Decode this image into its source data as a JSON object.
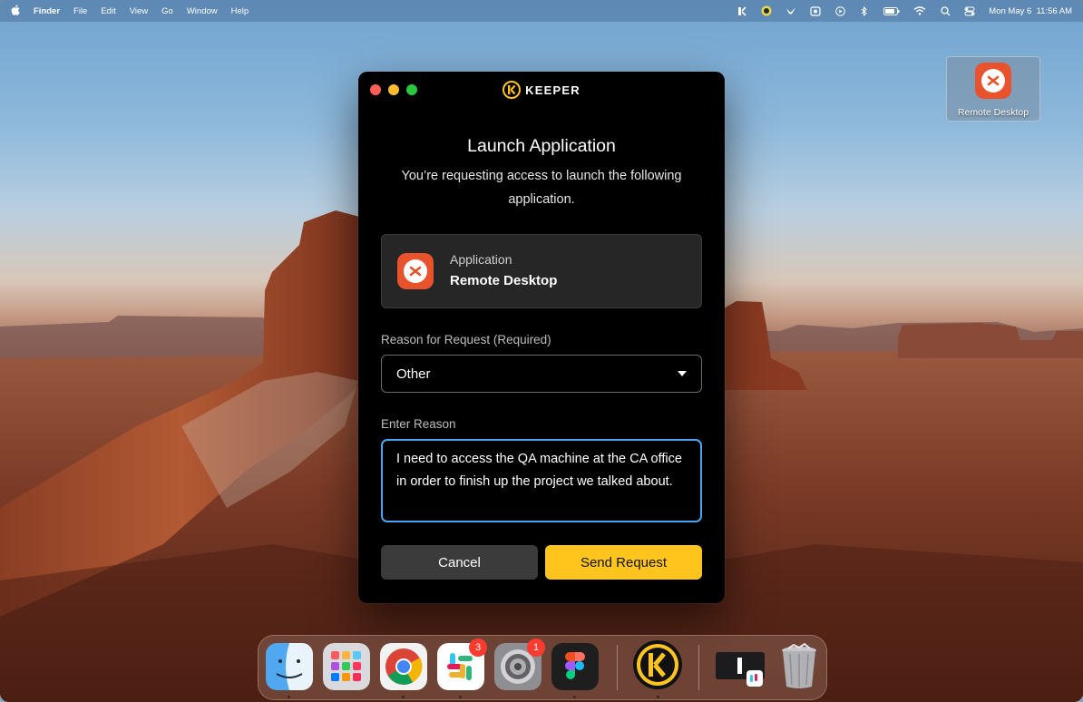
{
  "menubar": {
    "apple": "",
    "app_name": "Finder",
    "menus": [
      "File",
      "Edit",
      "View",
      "Go",
      "Window",
      "Help"
    ],
    "datetime": "Mon May 6  11:56 AM",
    "status_icons": [
      "keeper-icon",
      "sparrow-icon",
      "bird-icon",
      "screen-capture-icon",
      "play-icon",
      "bluetooth-icon",
      "battery-icon",
      "wifi-icon",
      "search-icon",
      "control-center-icon"
    ]
  },
  "desktop": {
    "icon_label": "Remote Desktop"
  },
  "dialog": {
    "brand": "KEEPER",
    "title": "Launch Application",
    "subtitle": "You’re requesting access to launch the following application.",
    "app_caption": "Application",
    "app_name": "Remote Desktop",
    "reason_label": "Reason for Request (Required)",
    "reason_value": "Other",
    "enter_label": "Enter Reason",
    "enter_value": "I need to access the QA machine at the CA office in order to finish up the project we talked about.",
    "cancel_label": "Cancel",
    "send_label": "Send Request"
  },
  "dock": {
    "apps": [
      "finder",
      "launchpad",
      "chrome",
      "slack",
      "system-settings",
      "figma",
      "keeper",
      "minimized-window",
      "trash"
    ],
    "badges": {
      "slack": "3",
      "system_settings": "1"
    }
  },
  "colors": {
    "accent": "#ffc51c",
    "focus": "#4ba3f2",
    "remote_desktop": "#e8532e"
  }
}
